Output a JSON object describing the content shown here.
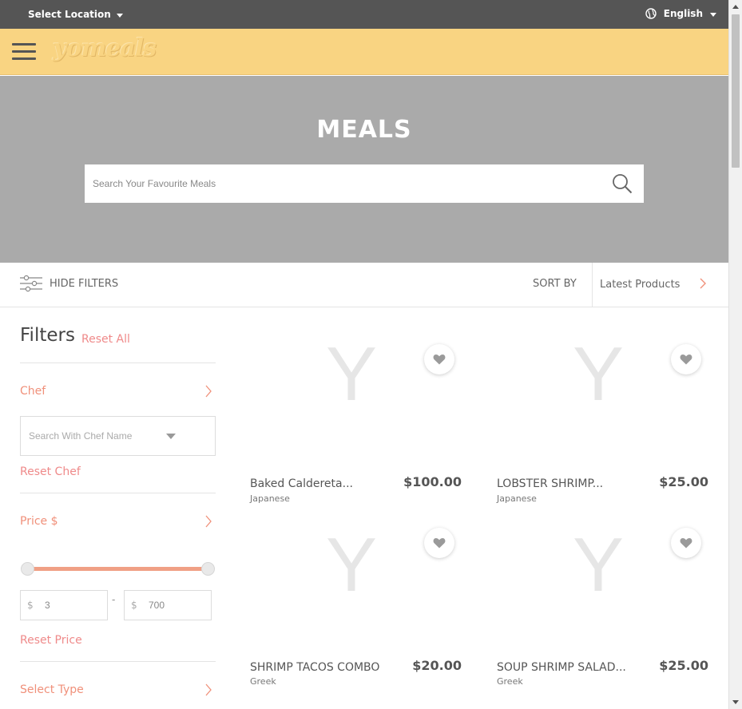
{
  "topbar": {
    "location_label": "Select Location",
    "language_label": "English"
  },
  "header": {
    "logo_text": "yomeals"
  },
  "hero": {
    "title": "MEALS",
    "search_placeholder": "Search Your Favourite Meals"
  },
  "filter_bar": {
    "hide_filters_label": "HIDE FILTERS",
    "sort_by_label": "SORT BY",
    "sort_value": "Latest Products"
  },
  "sidebar": {
    "title": "Filters",
    "reset_all": "Reset All",
    "chef": {
      "title": "Chef",
      "search_placeholder": "Search With Chef Name",
      "reset_label": "Reset Chef"
    },
    "price": {
      "title": "Price $",
      "currency": "$",
      "min_value": "3",
      "max_value": "700",
      "separator": "-",
      "reset_label": "Reset Price"
    },
    "type": {
      "title": "Select Type"
    }
  },
  "products": [
    {
      "name": "Baked Caldereta...",
      "cuisine": "Japanese",
      "price": "$100.00",
      "placeholder": "Y"
    },
    {
      "name": "LOBSTER SHRIMP...",
      "cuisine": "Japanese",
      "price": "$25.00",
      "placeholder": "Y"
    },
    {
      "name": "SHRIMP TACOS COMBO",
      "cuisine": "Greek",
      "price": "$20.00",
      "placeholder": "Y"
    },
    {
      "name": "SOUP SHRIMP SALAD...",
      "cuisine": "Greek",
      "price": "$25.00",
      "placeholder": "Y"
    }
  ],
  "colors": {
    "topbar": "#555555",
    "header": "#f9d482",
    "hero": "#aaaaaa",
    "accent": "#f0907a",
    "slider": "#f0a085"
  }
}
